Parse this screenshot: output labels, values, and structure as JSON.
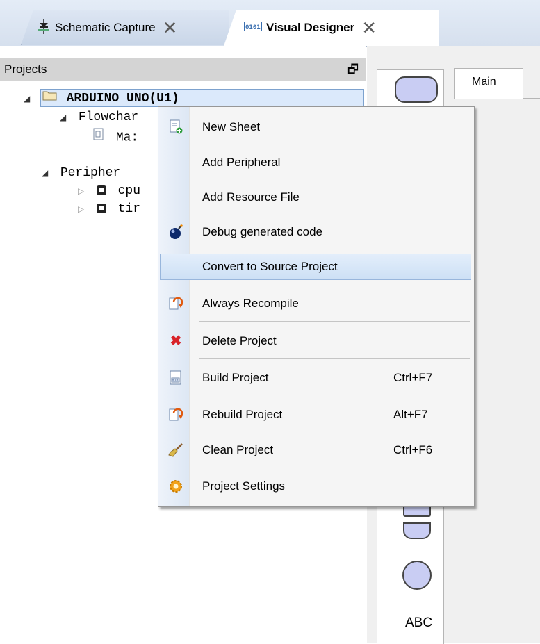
{
  "tabs": [
    {
      "label": "Schematic Capture",
      "icon": "schematic-icon",
      "active": false
    },
    {
      "label": "Visual Designer",
      "icon": "binary-icon",
      "active": true
    }
  ],
  "projects_panel": {
    "title": "Projects",
    "restore_icon": "restore-window-icon",
    "tree": {
      "root": "ARDUINO UNO(U1)",
      "flowchart": "Flowchar",
      "flowchart_child": "Ma:",
      "peripherals": "Peripher",
      "cpu": "cpu",
      "timer": "tir"
    }
  },
  "right_pane": {
    "tab_label": "Main",
    "toolbox_text": "ABC",
    "shape_color": "#c9cdf3"
  },
  "context_menu": {
    "items": [
      {
        "label": "New Sheet",
        "icon": "new-sheet-icon",
        "shortcut": ""
      },
      {
        "label": "Add Peripheral",
        "icon": "",
        "shortcut": ""
      },
      {
        "label": "Add Resource File",
        "icon": "",
        "shortcut": ""
      },
      {
        "label": "Debug generated code",
        "icon": "debug-bomb-icon",
        "shortcut": ""
      },
      {
        "label": "Convert to Source Project",
        "icon": "",
        "shortcut": "",
        "highlighted": true
      },
      {
        "label": "Always Recompile",
        "icon": "recompile-icon",
        "shortcut": ""
      },
      {
        "label": "Delete Project",
        "icon": "delete-x-icon",
        "shortcut": ""
      },
      {
        "label": "Build Project",
        "icon": "build-icon",
        "shortcut": "Ctrl+F7"
      },
      {
        "label": "Rebuild Project",
        "icon": "rebuild-icon",
        "shortcut": "Alt+F7"
      },
      {
        "label": "Clean Project",
        "icon": "broom-icon",
        "shortcut": "Ctrl+F6"
      },
      {
        "label": "Project Settings",
        "icon": "gear-icon",
        "shortcut": ""
      }
    ],
    "highlight_color": "#cde0f5"
  }
}
